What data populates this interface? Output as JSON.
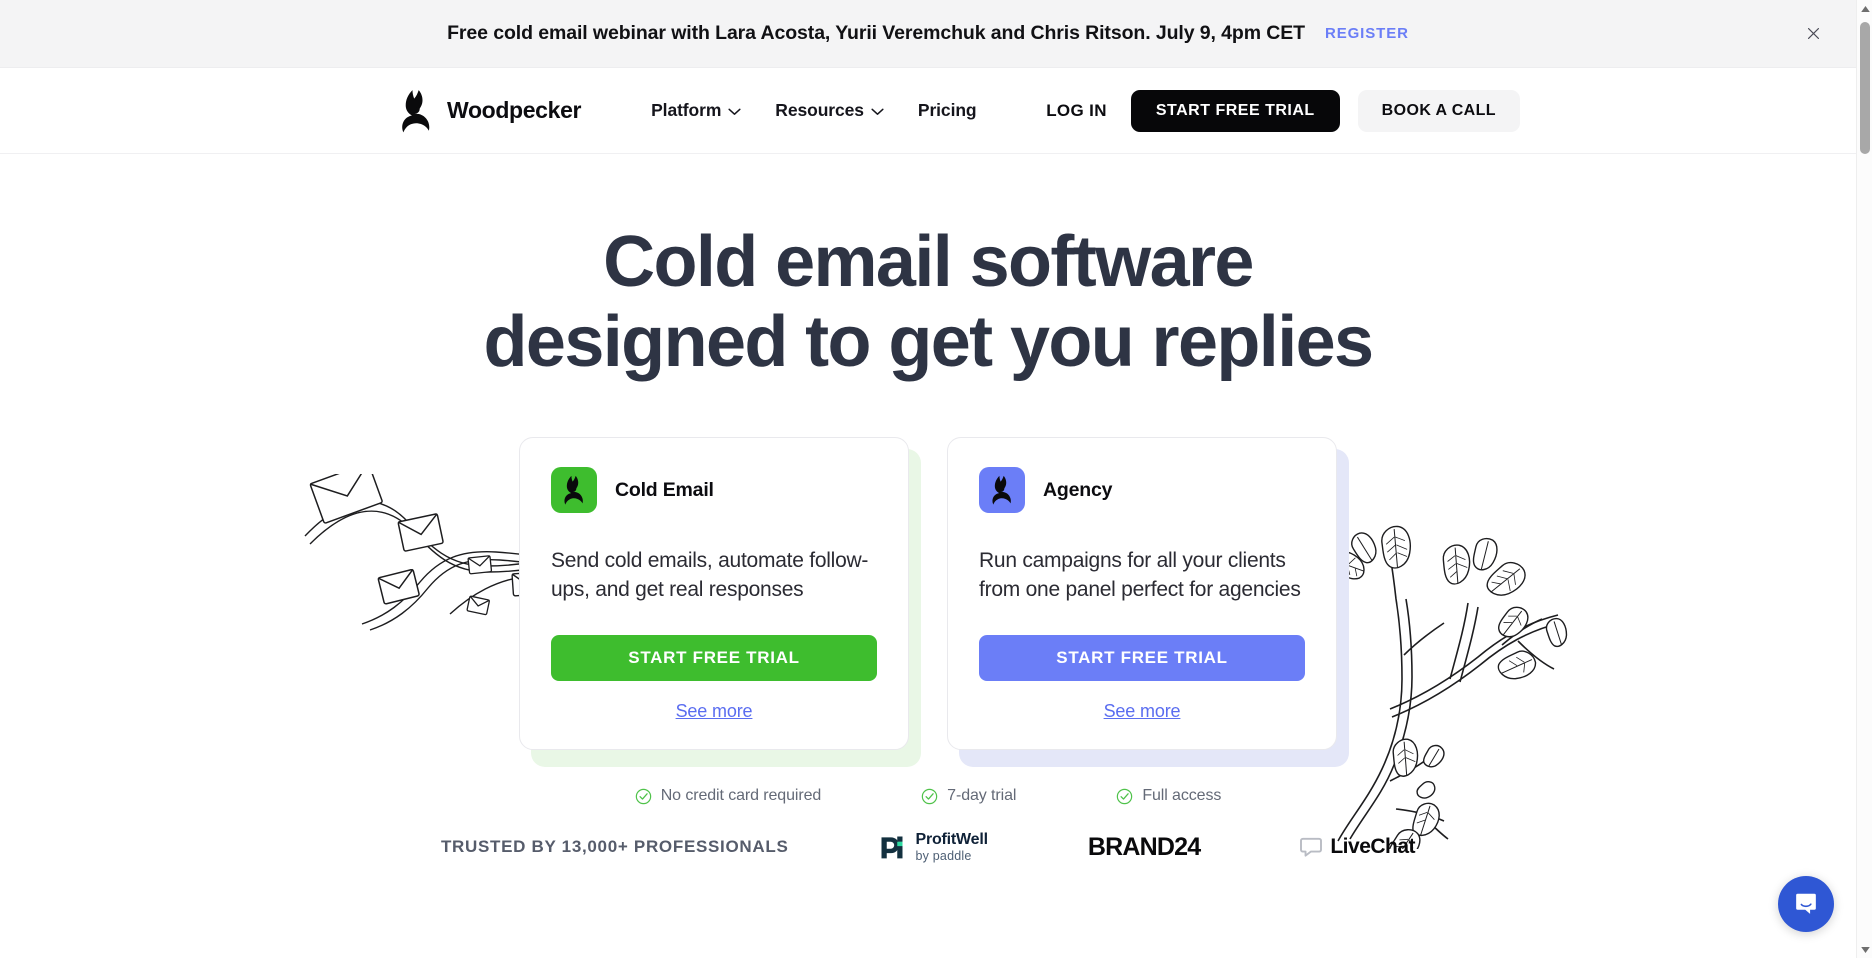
{
  "banner": {
    "text": "Free cold email webinar with Lara Acosta, Yurii Veremchuk and Chris Ritson. July 9, 4pm CET",
    "cta_label": "REGISTER",
    "close_label": "×",
    "background": "#f4f4f5",
    "cta_color": "#6b7ef7"
  },
  "nav": {
    "brand_name": "Woodpecker",
    "links": [
      {
        "label": "Platform",
        "has_dropdown": true
      },
      {
        "label": "Resources",
        "has_dropdown": true
      },
      {
        "label": "Pricing",
        "has_dropdown": false
      }
    ],
    "login_label": "LOG IN",
    "trial_label": "START FREE TRIAL",
    "call_label": "BOOK A CALL"
  },
  "hero": {
    "title_line1": "Cold email software",
    "title_line2": "designed to get you replies",
    "title_color": "#2e3444"
  },
  "cards": [
    {
      "title": "Cold Email",
      "description": "Send cold emails, automate follow-ups, and get real responses",
      "button_label": "START FREE TRIAL",
      "link_label": "See more",
      "accent": "#3ebd2e",
      "shadow": "#e9f7e6"
    },
    {
      "title": "Agency",
      "description": "Run campaigns for all your clients from one panel perfect for agencies",
      "button_label": "START FREE TRIAL",
      "link_label": "See more",
      "accent": "#6b7ef7",
      "shadow": "#e4e7f8"
    }
  ],
  "benefits": [
    {
      "label": "No credit card required"
    },
    {
      "label": "7-day trial"
    },
    {
      "label": "Full access"
    }
  ],
  "trusted": {
    "label": "TRUSTED BY 13,000+ PROFESSIONALS",
    "logos": [
      {
        "name": "ProfitWell",
        "primary": "ProfitWell",
        "secondary": "by paddle"
      },
      {
        "name": "Brand24",
        "primary": "BRAND24",
        "secondary": ""
      },
      {
        "name": "LiveChat",
        "primary": "LiveChat",
        "secondary": ""
      }
    ]
  },
  "chat": {
    "label": "Open chat",
    "color": "#2f57d4"
  }
}
